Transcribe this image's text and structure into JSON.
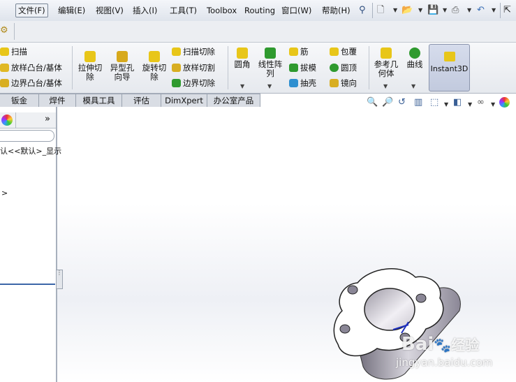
{
  "menu": {
    "items": [
      "文件(F)",
      "编辑(E)",
      "视图(V)",
      "插入(I)",
      "工具(T)",
      "Toolbox",
      "Routing",
      "窗口(W)",
      "帮助(H)"
    ]
  },
  "ribbon": {
    "sweep": "扫描",
    "loft_boss": "放样凸台/基体",
    "boundary_boss": "边界凸台/基体",
    "extruded_cut": "拉伸切\n除",
    "hole_wizard": "异型孔\n向导",
    "revolved_cut": "旋转切\n除",
    "swept_cut": "扫描切除",
    "lofted_cut": "放样切割",
    "boundary_cut": "边界切除",
    "fillet": "圆角",
    "linear_pattern": "线性阵\n列",
    "rib": "筋",
    "draft": "拔模",
    "shell": "抽壳",
    "wrap": "包覆",
    "dome": "圆顶",
    "mirror": "镜向",
    "ref_geometry": "参考几\n何体",
    "curves": "曲线",
    "instant3d": "Instant3D"
  },
  "tabs": [
    "钣金",
    "焊件",
    "模具工具",
    "评估",
    "DimXpert",
    "办公室产品"
  ],
  "feature_tree": {
    "config_text": "认<<默认>_显示",
    "arrow": ">",
    "expand": "»"
  },
  "watermark": {
    "brand": "Bai",
    "brand_cn": "经验",
    "url": "jingyan.baidu.com"
  },
  "colors": {
    "accent": "#3a5f95",
    "ribbon_icon_yellow": "#e8c619",
    "ribbon_icon_green": "#2f9a2f"
  }
}
